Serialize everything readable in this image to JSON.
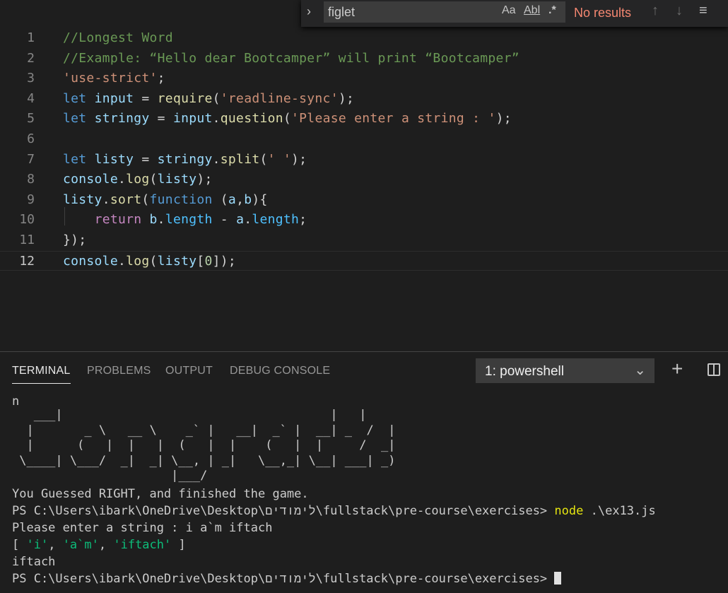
{
  "editor": {
    "lines": [
      {
        "num": "1",
        "tokens": [
          {
            "c": "c-com",
            "t": "//Longest Word"
          }
        ]
      },
      {
        "num": "2",
        "tokens": [
          {
            "c": "c-com",
            "t": "//Example: “Hello dear Bootcamper” will print “Bootcamper”"
          }
        ]
      },
      {
        "num": "3",
        "tokens": [
          {
            "c": "c-str",
            "t": "'use-strict'"
          },
          {
            "c": "c-pl",
            "t": ";"
          }
        ]
      },
      {
        "num": "4",
        "tokens": [
          {
            "c": "c-kw",
            "t": "let "
          },
          {
            "c": "c-var",
            "t": "input"
          },
          {
            "c": "c-pl",
            "t": " = "
          },
          {
            "c": "c-fn",
            "t": "require"
          },
          {
            "c": "c-pl",
            "t": "("
          },
          {
            "c": "c-str",
            "t": "'readline-sync'"
          },
          {
            "c": "c-pl",
            "t": ");"
          }
        ]
      },
      {
        "num": "5",
        "tokens": [
          {
            "c": "c-kw",
            "t": "let "
          },
          {
            "c": "c-var",
            "t": "stringy"
          },
          {
            "c": "c-pl",
            "t": " = "
          },
          {
            "c": "c-var",
            "t": "input"
          },
          {
            "c": "c-pl",
            "t": "."
          },
          {
            "c": "c-fn",
            "t": "question"
          },
          {
            "c": "c-pl",
            "t": "("
          },
          {
            "c": "c-str",
            "t": "'Please enter a string : '"
          },
          {
            "c": "c-pl",
            "t": ");"
          }
        ]
      },
      {
        "num": "6",
        "tokens": []
      },
      {
        "num": "7",
        "tokens": [
          {
            "c": "c-kw",
            "t": "let "
          },
          {
            "c": "c-var",
            "t": "listy"
          },
          {
            "c": "c-pl",
            "t": " = "
          },
          {
            "c": "c-var",
            "t": "stringy"
          },
          {
            "c": "c-pl",
            "t": "."
          },
          {
            "c": "c-fn",
            "t": "split"
          },
          {
            "c": "c-pl",
            "t": "("
          },
          {
            "c": "c-str",
            "t": "' '"
          },
          {
            "c": "c-pl",
            "t": ");"
          }
        ]
      },
      {
        "num": "8",
        "tokens": [
          {
            "c": "c-var",
            "t": "console"
          },
          {
            "c": "c-pl",
            "t": "."
          },
          {
            "c": "c-fn",
            "t": "log"
          },
          {
            "c": "c-pl",
            "t": "("
          },
          {
            "c": "c-var",
            "t": "listy"
          },
          {
            "c": "c-pl",
            "t": ");"
          }
        ]
      },
      {
        "num": "9",
        "tokens": [
          {
            "c": "c-var",
            "t": "listy"
          },
          {
            "c": "c-pl",
            "t": "."
          },
          {
            "c": "c-fn",
            "t": "sort"
          },
          {
            "c": "c-pl",
            "t": "("
          },
          {
            "c": "c-kw",
            "t": "function"
          },
          {
            "c": "c-pl",
            "t": " ("
          },
          {
            "c": "c-var",
            "t": "a"
          },
          {
            "c": "c-pl",
            "t": ","
          },
          {
            "c": "c-var",
            "t": "b"
          },
          {
            "c": "c-pl",
            "t": "){"
          }
        ]
      },
      {
        "num": "10",
        "tokens": [
          {
            "c": "c-pl",
            "t": "    "
          },
          {
            "c": "c-kw2",
            "t": "return "
          },
          {
            "c": "c-var",
            "t": "b"
          },
          {
            "c": "c-pl",
            "t": "."
          },
          {
            "c": "c-prop",
            "t": "length"
          },
          {
            "c": "c-pl",
            "t": " - "
          },
          {
            "c": "c-var",
            "t": "a"
          },
          {
            "c": "c-pl",
            "t": "."
          },
          {
            "c": "c-prop",
            "t": "length"
          },
          {
            "c": "c-pl",
            "t": ";"
          }
        ]
      },
      {
        "num": "11",
        "tokens": [
          {
            "c": "c-pl",
            "t": "});"
          }
        ]
      },
      {
        "num": "12",
        "tokens": [
          {
            "c": "c-var",
            "t": "console"
          },
          {
            "c": "c-pl",
            "t": "."
          },
          {
            "c": "c-fn",
            "t": "log"
          },
          {
            "c": "c-pl",
            "t": "("
          },
          {
            "c": "c-var",
            "t": "listy"
          },
          {
            "c": "c-pl",
            "t": "["
          },
          {
            "c": "c-num",
            "t": "0"
          },
          {
            "c": "c-pl",
            "t": "]);"
          }
        ]
      }
    ],
    "current_line": "12"
  },
  "find": {
    "query": "figlet",
    "match_case_label": "Aa",
    "whole_word_label": "Abl",
    "regex_label": ".*",
    "status": "No results"
  },
  "panel": {
    "tabs": [
      "TERMINAL",
      "PROBLEMS",
      "OUTPUT",
      "DEBUG CONSOLE"
    ],
    "active_tab": "TERMINAL",
    "terminal_selected": "1: powershell"
  },
  "terminal": {
    "line_n": "n",
    "figlet_lines": [
      "   ___|                                     |   |",
      "  |       _ \\   __ \\    _` |   __|  _` |  __| _  /  |",
      "  |      (   |  |   |  (   |  |    (   |  |     /  _|",
      " \\____| \\___/  _|  _| \\__, | _|   \\__,_| \\__| ___| _)",
      "                      |___/"
    ],
    "guessed": "You Guessed RIGHT, and finished the game.",
    "prompt1_path": "PS C:\\Users\\ibark\\OneDrive\\Desktop\\לימודים\\fullstack\\pre-course\\exercises>",
    "prompt1_cmd_node": "node",
    "prompt1_cmd_arg": ".\\ex13.js",
    "please_enter": "Please enter a string : i a`m iftach",
    "array_open": "[ ",
    "array_items": [
      "'i'",
      "'a`m'",
      "'iftach'"
    ],
    "array_close": " ]",
    "result": "iftach",
    "prompt2_path": "PS C:\\Users\\ibark\\OneDrive\\Desktop\\לימודים\\fullstack\\pre-course\\exercises>"
  },
  "colors": {
    "comment": "#6a9955",
    "string": "#ce9178",
    "keyword": "#569cd6",
    "variable": "#9cdcfe",
    "function": "#dcdcaa",
    "no_results": "#f48771",
    "terminal_yellow": "#e5e510",
    "terminal_green": "#0dbc79"
  },
  "icons": [
    "chevron-right-icon",
    "match-case-icon",
    "whole-word-icon",
    "regex-icon",
    "arrow-up-icon",
    "arrow-down-icon",
    "menu-icon",
    "chevron-down-icon",
    "plus-icon",
    "split-icon"
  ]
}
